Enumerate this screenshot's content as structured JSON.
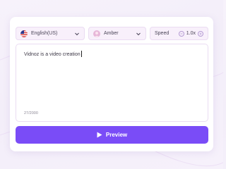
{
  "language": {
    "label": "English(US)",
    "icon": "us-flag-icon"
  },
  "voice": {
    "label": "Amber",
    "icon": "avatar-icon"
  },
  "speed": {
    "label": "Speed",
    "value": "1.0x",
    "decrease_icon": "minus-icon",
    "increase_icon": "plus-icon"
  },
  "editor": {
    "text": "Vidnoz is a video creation",
    "counter": "27/2000"
  },
  "preview": {
    "label": "Preview",
    "icon": "play-icon"
  },
  "colors": {
    "accent": "#7a4cf7",
    "control_bg": "#f8f0fb",
    "border": "#eadcf2"
  }
}
